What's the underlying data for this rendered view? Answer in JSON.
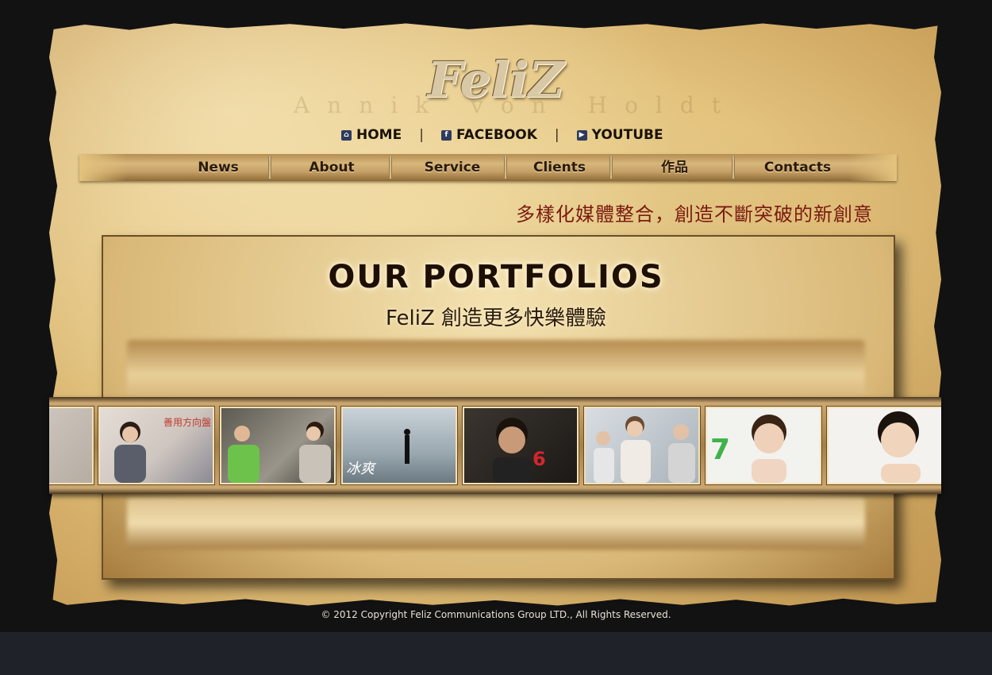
{
  "brand": {
    "logo_text": "FeliZ",
    "background_name": "Annik  von  Holdt"
  },
  "top_nav": [
    {
      "label": "HOME",
      "icon": "home-icon"
    },
    {
      "label": "FACEBOOK",
      "icon": "facebook-icon"
    },
    {
      "label": "YOUTUBE",
      "icon": "youtube-icon"
    }
  ],
  "top_nav_separator": "|",
  "main_nav": [
    "News",
    "About",
    "Service",
    "Clients",
    "作品",
    "Contacts"
  ],
  "tagline": "多樣化媒體整合，創造不斷突破的新創意",
  "portfolio": {
    "title": "OUR PORTFOLIOS",
    "subtitle": "FeliZ 創造更多快樂體驗"
  },
  "thumbnails": [
    {
      "alt": "partial-thumbnail",
      "caption": ""
    },
    {
      "alt": "woman-presenter-ad",
      "caption": "善用方向盤 危險不上"
    },
    {
      "alt": "family-in-car-ad",
      "caption": ""
    },
    {
      "alt": "waterfall-performer-ad",
      "caption": "冰爽"
    },
    {
      "alt": "young-man-portrait-ad",
      "caption": "6"
    },
    {
      "alt": "women-in-car-ad",
      "caption": ""
    },
    {
      "alt": "skincare-model-ad",
      "caption": "7"
    },
    {
      "alt": "skincare-model-closeup-ad",
      "caption": ""
    }
  ],
  "footer": "© 2012 Copyright Feliz Communications Group LTD., All Rights Reserved.",
  "colors": {
    "page_bg": "#121212",
    "parchment": "#e3c37e",
    "tagline": "#7a1a10",
    "footer_band": "#1f2329"
  }
}
